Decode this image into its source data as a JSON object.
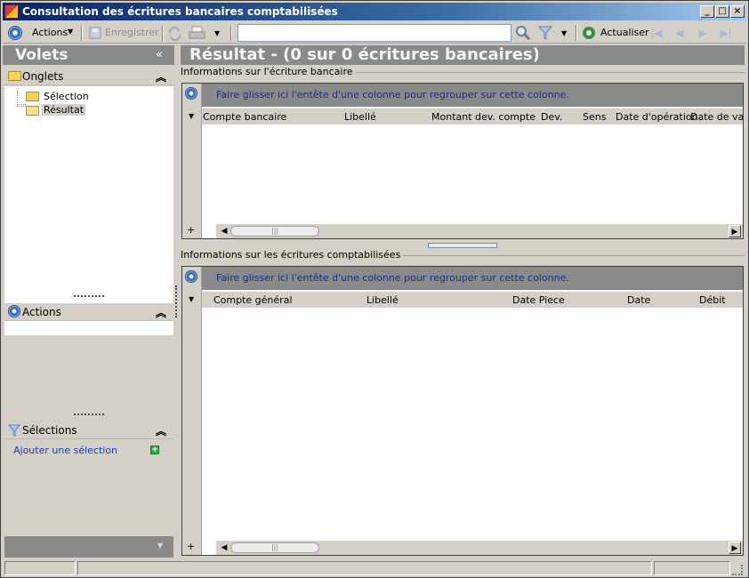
{
  "window": {
    "title": "Consultation des écritures bancaires comptabilisées"
  },
  "toolbar": {
    "actions_label": "Actions",
    "save_label": "Enregistrer",
    "search_value": "",
    "refresh_label": "Actualiser"
  },
  "left_pane": {
    "title": "Volets",
    "onglets": {
      "title": "Onglets",
      "items": [
        {
          "label": "Sélection",
          "selected": false
        },
        {
          "label": "Résultat",
          "selected": true
        }
      ]
    },
    "actions": {
      "title": "Actions"
    },
    "selections": {
      "title": "Sélections",
      "add_label": "Ajouter une sélection"
    }
  },
  "main": {
    "title": "Résultat - (0 sur 0 écritures bancaires)",
    "bank_grid": {
      "group_title": "Informations sur l'écriture bancaire",
      "group_hint": "Faire glisser ici l'entête d'une colonne pour regrouper sur cette colonne.",
      "columns": [
        "Compte bancaire",
        "Libellé",
        "Montant dev. compte",
        "Dev.",
        "Sens",
        "Date d'opération",
        "Date de vale"
      ]
    },
    "accounting_grid": {
      "group_title": "Informations sur les écritures comptabilisées",
      "group_hint": "Faire glisser ici l'entête d'une colonne pour regrouper sur cette colonne.",
      "columns": [
        "Compte général",
        "Libellé",
        "Date Piece",
        "Date",
        "Débit"
      ]
    }
  },
  "colors": {
    "pane_header": "#8a8a8a",
    "hint_text": "#1c2f7c",
    "link": "#1b3fb8"
  },
  "icons": [
    "app-icon",
    "actions-icon",
    "save-icon",
    "sync-icon",
    "print-icon",
    "search-icon",
    "filter-icon",
    "refresh-icon",
    "first-icon",
    "prev-icon",
    "next-icon",
    "last-icon",
    "folder-icon",
    "filter-icon",
    "add-icon"
  ]
}
